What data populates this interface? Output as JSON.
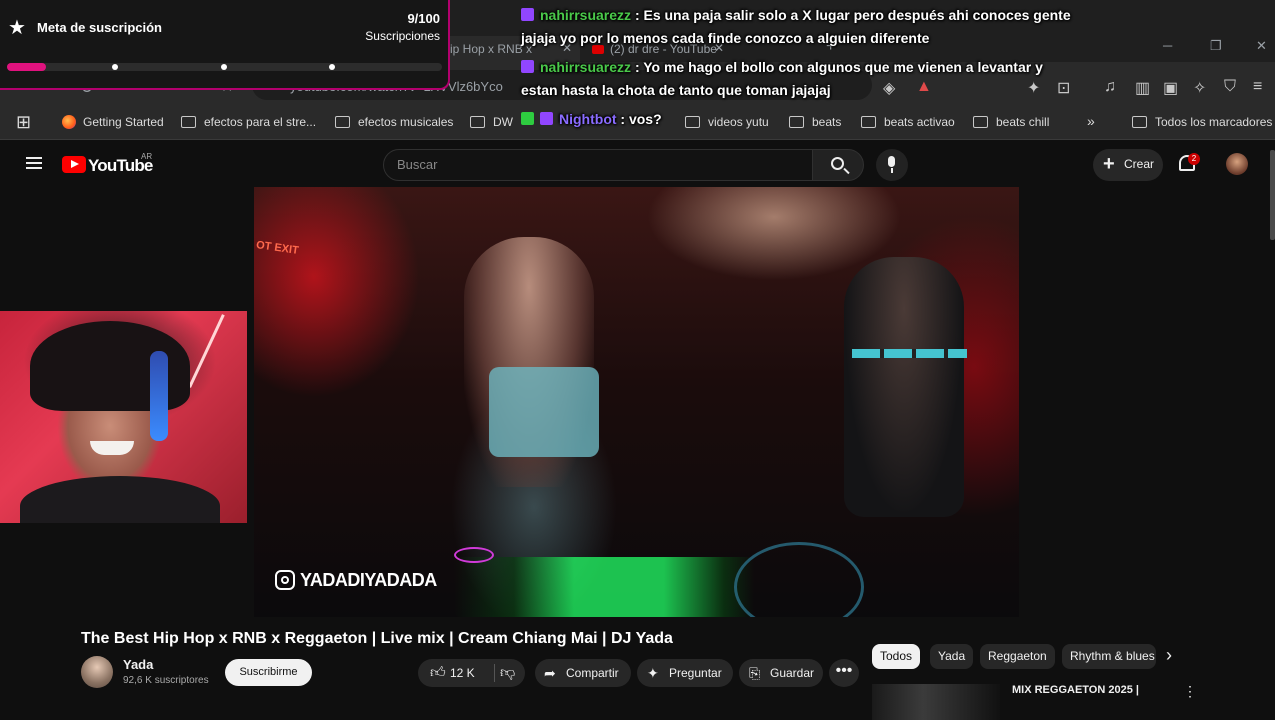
{
  "browser": {
    "tabs": [
      {
        "label": "ip Hop x RNB x"
      },
      {
        "label": "(2) dr dre - YouTube"
      }
    ],
    "url": "youtube.com/watch?v=LXVVlz6bYco",
    "window_controls": {
      "minimize": "─",
      "restore": "❐",
      "close": "✕"
    },
    "bookmarks": [
      {
        "label": "Getting Started",
        "icon": "firefox-icon"
      },
      {
        "label": "efectos para el stre...",
        "icon": "folder-icon"
      },
      {
        "label": "efectos musicales",
        "icon": "folder-icon"
      },
      {
        "label": "DW",
        "icon": "folder-icon"
      },
      {
        "label": "videos yutu",
        "icon": "folder-icon"
      },
      {
        "label": "beats",
        "icon": "folder-icon"
      },
      {
        "label": "beats activao",
        "icon": "folder-icon"
      },
      {
        "label": "beats chill",
        "icon": "folder-icon"
      }
    ],
    "bookmarks_overflow": "»",
    "all_bookmarks": "Todos los marcadores"
  },
  "youtube": {
    "logo_text": "YouTube",
    "country_code": "AR",
    "search_placeholder": "Buscar",
    "create_label": "Crear",
    "notification_count": "2"
  },
  "goal": {
    "title": "Meta de suscripción",
    "count": "9/100",
    "subtitle": "Suscripciones",
    "progress": 0.09,
    "accent": "#e0127e"
  },
  "chat": {
    "messages": [
      {
        "user": "nahirrsuarezz",
        "text": ": Es una paja salir solo a X lugar pero después ahi conoces gente",
        "text2": "jajaja yo por lo menos cada finde conozco a alguien diferente"
      },
      {
        "user": "nahirrsuarezz",
        "text": ": Yo me hago el bollo con algunos que me vienen a levantar y",
        "text2": "estan hasta la chota de tanto que toman jajajaj"
      },
      {
        "user": "Nightbot",
        "text": ": vos?"
      }
    ]
  },
  "video": {
    "watermark": "YADADIYADADA",
    "sign": "OT EXIT",
    "title": "The Best Hip Hop x RNB x Reggaeton | Live mix | Cream Chiang Mai | DJ Yada",
    "channel": "Yada",
    "subscribers": "92,6 K suscriptores",
    "subscribe_label": "Suscribirme",
    "likes": "12 K",
    "share_label": "Compartir",
    "ask_label": "Preguntar",
    "save_label": "Guardar",
    "more_label": "•••"
  },
  "recommendations": {
    "chips": [
      "Todos",
      "Yada",
      "Reggaeton",
      "Rhythm & blues"
    ],
    "first_title": "MIX REGGAETON 2025 |"
  }
}
